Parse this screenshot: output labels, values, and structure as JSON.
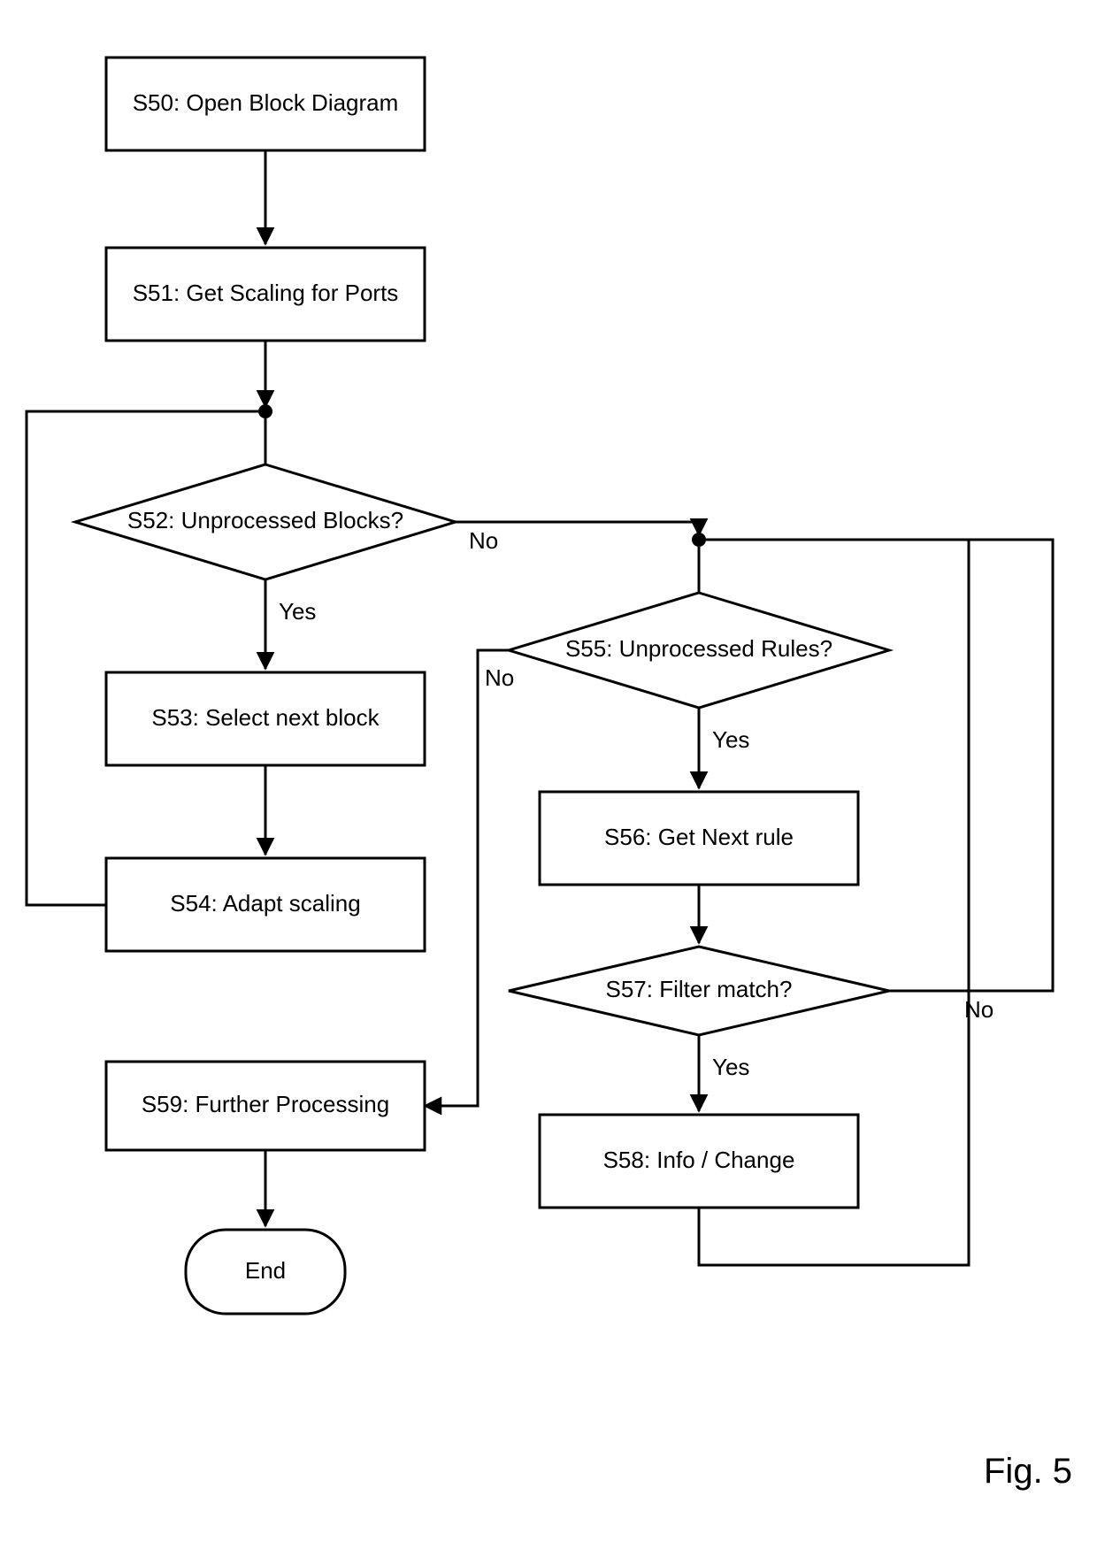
{
  "nodes": {
    "s50": "S50: Open Block Diagram",
    "s51": "S51: Get Scaling for Ports",
    "s52": "S52: Unprocessed Blocks?",
    "s53": "S53: Select next block",
    "s54": "S54: Adapt scaling",
    "s55": "S55: Unprocessed Rules?",
    "s56": "S56: Get Next rule",
    "s57": "S57: Filter match?",
    "s58": "S58: Info / Change",
    "s59": "S59: Further Processing",
    "end": "End"
  },
  "edges": {
    "yes_s52": "Yes",
    "no_s52": "No",
    "yes_s55": "Yes",
    "no_s55": "No",
    "yes_s57": "Yes",
    "no_s57": "No"
  },
  "caption": "Fig. 5"
}
